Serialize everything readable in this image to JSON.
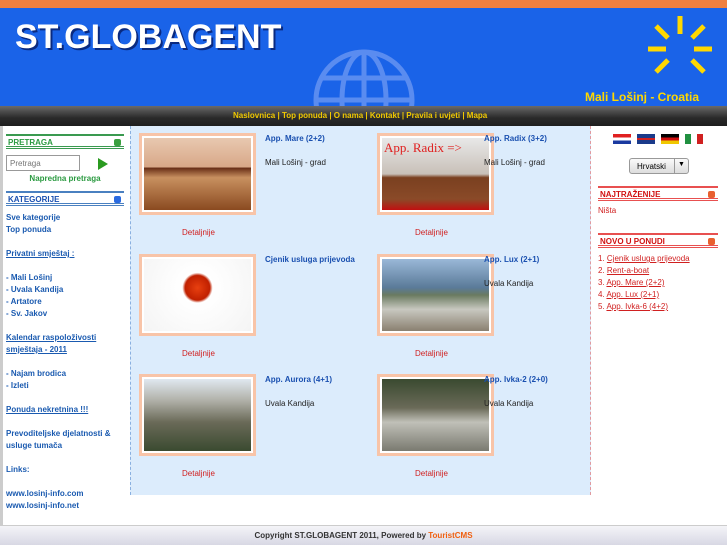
{
  "header": {
    "logo": "ST.GLOBAGENT",
    "tagline": "Mali Lošinj - Croatia"
  },
  "nav": [
    "Naslovnica",
    "Top ponuda",
    "O nama",
    "Kontakt",
    "Pravila i uvjeti",
    "Mapa"
  ],
  "left": {
    "search_title": "PRETRAGA",
    "search_placeholder": "Pretraga",
    "advanced": "Napredna pretraga",
    "categories_title": "KATEGORIJE",
    "items": [
      "Sve kategorije",
      "Top ponuda",
      "Privatni smještaj :",
      "- Mali Lošinj",
      "- Uvala Kandija",
      "- Artatore",
      "- Sv. Jakov",
      "Kalendar raspoloživosti smještaja - 2011",
      "- Najam brodica",
      "- Izleti",
      "Ponuda nekretnina !!!",
      "Prevoditeljske djelatnosti & usluge tumača",
      "Links:",
      "www.losinj-info.com",
      "www.losinj-info.net"
    ]
  },
  "listings": [
    {
      "title": "App. Mare (2+2)",
      "location": "Mali Lošinj - grad",
      "details": "Detaljnije"
    },
    {
      "title": "App. Radix (3+2)",
      "location": "Mali Lošinj - grad",
      "details": "Detaljnije",
      "overlay": "App. Radix =>"
    },
    {
      "title": "Cjenik usluga prijevoda",
      "location": "",
      "details": "Detaljnije"
    },
    {
      "title": "App. Lux (2+1)",
      "location": "Uvala Kandija",
      "details": "Detaljnije"
    },
    {
      "title": "App. Aurora (4+1)",
      "location": "Uvala Kandija",
      "details": "Detaljnije"
    },
    {
      "title": "App. Ivka-2 (2+0)",
      "location": "Uvala Kandija",
      "details": "Detaljnije"
    }
  ],
  "right": {
    "language": "Hrvatski",
    "popular_title": "NAJTRAŽENIJE",
    "popular_text": "Ništa",
    "new_title": "NOVO U PONUDI",
    "new_items": [
      "1. ",
      "Cjenik usluga prijevoda",
      "2. ",
      "Rent-a-boat",
      "3. ",
      "App. Mare (2+2)",
      "4. ",
      "App. Lux (2+1)",
      "5. ",
      "App. Ivka-6 (4+2)"
    ]
  },
  "footer": {
    "text": "Copyright ST.GLOBAGENT 2011, Powered by ",
    "brand": "TouristCMS"
  }
}
